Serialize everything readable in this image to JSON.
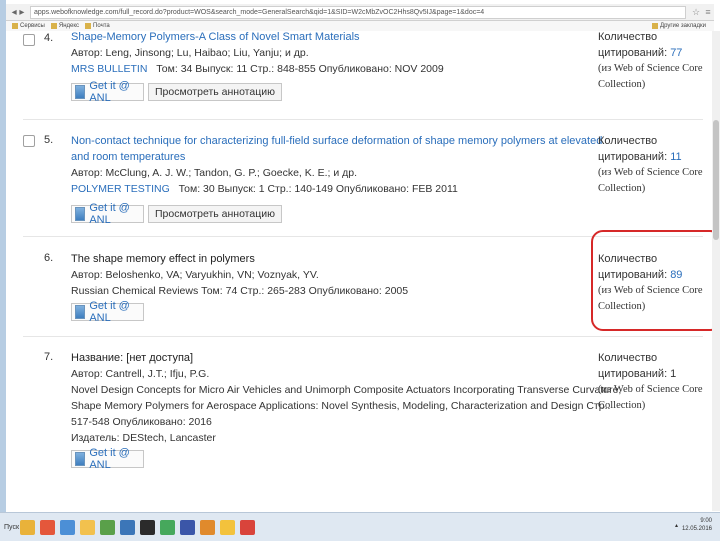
{
  "browser": {
    "url": "apps.webofknowledge.com/full_record.do?product=WOS&search_mode=GeneralSearch&qid=1&SID=W2cMbZvOC2Hhs8Qv5IJ&page=1&doc=4",
    "bookmarks": [
      "Сервисы",
      "Яндекс",
      "Почта"
    ],
    "other_bookmarks": "Другие закладки"
  },
  "records": [
    {
      "number": "4.",
      "title": "Shape-Memory Polymers-A Class of Novel Smart Materials",
      "authors": "Автор: Leng, Jinsong; Lu, Haibao; Liu, Yanju; и др.",
      "source": "MRS BULLETIN",
      "details": "Том: 34   Выпуск: 11   Стр.: 848-855   Опубликовано: NOV 2009",
      "getit": "Get it @ ANL",
      "abstract": "Просмотреть аннотацию",
      "cites_label1": "Количество",
      "cites_label2": "цитирований:",
      "cites_count": "77",
      "wos1": "(из Web of Science Core",
      "wos2": "Collection)"
    },
    {
      "number": "5.",
      "title_line1": "Non-contact technique for characterizing full-field surface deformation of shape memory polymers at elevated",
      "title_line2": "and room temperatures",
      "authors": "Автор: McClung, A. J. W.; Tandon, G. P.; Goecke, K. E.; и др.",
      "source": "POLYMER TESTING",
      "details": "Том: 30   Выпуск: 1   Стр.: 140-149   Опубликовано: FEB 2011",
      "getit": "Get it @ ANL",
      "abstract": "Просмотреть аннотацию",
      "cites_label1": "Количество",
      "cites_label2": "цитирований:",
      "cites_count": "11",
      "wos1": "(из Web of Science Core",
      "wos2": "Collection)"
    },
    {
      "number": "6.",
      "title": "The shape memory effect in polymers",
      "authors": "Автор: Beloshenko, VA; Varyukhin, VN; Voznyak, YV.",
      "source_line": "Russian Chemical Reviews  Том: 74   Стр.: 265-283   Опубликовано: 2005",
      "getit": "Get it @ ANL",
      "cites_label1": "Количество",
      "cites_label2": "цитирований:",
      "cites_count": "89",
      "wos1": "(из Web of Science Core",
      "wos2": "Collection)"
    },
    {
      "number": "7.",
      "title": "Название: [нет доступа]",
      "authors": "Автор: Cantrell, J.T.; Ifju, P.G.",
      "line3": "Novel Design Concepts for Micro Air Vehicles and Unimorph Composite Actuators Incorporating Transverse Curvature,",
      "line4": "Shape Memory Polymers for Aerospace Applications: Novel Synthesis, Modeling, Characterization and Design  Стр.:",
      "line5": "517-548   Опубликовано: 2016",
      "line6": "Издатель: DEStech, Lancaster",
      "getit": "Get it @ ANL",
      "cites_label1": "Количество",
      "cites_label2": "цитирований: 1",
      "wos1": "(из Web of Science Core",
      "wos2": "Collection)"
    }
  ],
  "taskbar": {
    "start": "Пуск",
    "clock_time": "9:00",
    "clock_date": "12.05.2016",
    "icon_colors": [
      "#e9b23a",
      "#e4573b",
      "#4c8fd6",
      "#f2c14e",
      "#5aa04a",
      "#3c76b8",
      "#2b2b2b",
      "#46a85c",
      "#3b56a8",
      "#e08a2c",
      "#f3c23c",
      "#d9443b"
    ]
  },
  "colors": {
    "link": "#2a6ebb",
    "highlight": "#d62828"
  }
}
